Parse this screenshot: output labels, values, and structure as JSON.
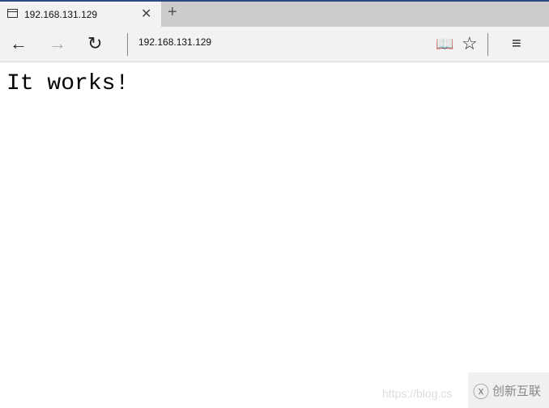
{
  "tab": {
    "title": "192.168.131.129",
    "close_icon": "close-icon",
    "new_tab_icon": "plus-icon"
  },
  "toolbar": {
    "address": "192.168.131.129",
    "icons": [
      "arrow-left-icon",
      "arrow-right-icon",
      "refresh-icon",
      "reading-view-icon",
      "star-icon",
      "hub-menu-icon"
    ]
  },
  "page": {
    "heading": "It works!"
  },
  "watermark": {
    "text": "https://blog.cs",
    "logo_text": "创新互联"
  }
}
